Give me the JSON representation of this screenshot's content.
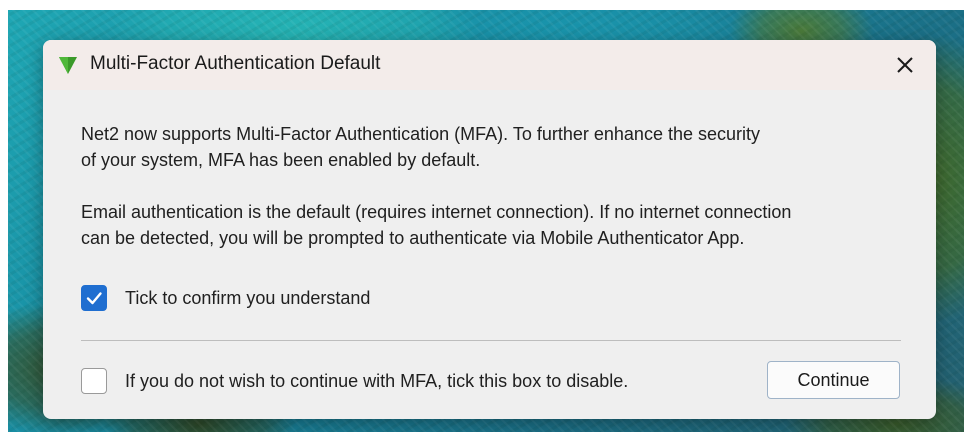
{
  "dialog": {
    "title": "Multi-Factor Authentication Default",
    "app_icon": "green-triangle-icon",
    "close_icon": "close-icon",
    "paragraph1_line1": "Net2 now supports Multi-Factor Authentication (MFA). To further enhance the security",
    "paragraph1_line2": "of your system, MFA has been enabled by default.",
    "paragraph2_line1": "Email authentication is the default (requires internet connection). If no internet connection",
    "paragraph2_line2": "can be detected, you will be prompted to authenticate via Mobile Authenticator App.",
    "confirm_checkbox": {
      "label": "Tick to confirm you understand",
      "checked": true
    },
    "disable_checkbox": {
      "label": "If you do not wish to continue with MFA, tick this box to disable.",
      "checked": false
    },
    "continue_label": "Continue"
  },
  "colors": {
    "accent": "#1f6ed0",
    "icon_green": "#3a9a2a",
    "titlebar": "#f3ecea",
    "dialog_bg": "#efefef"
  }
}
